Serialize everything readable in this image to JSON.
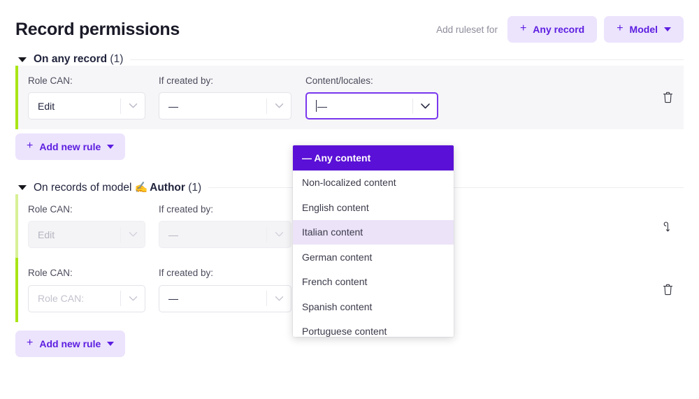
{
  "header": {
    "title": "Record permissions",
    "hint": "Add ruleset for",
    "any_record_button": "Any record",
    "model_button": "Model",
    "plus": "+"
  },
  "sections": [
    {
      "title_prefix": "On any record",
      "count": "(1)",
      "add_rule_label": "Add new rule",
      "rows": [
        {
          "shaded": true,
          "disabled": false,
          "action_icon": "trash-icon",
          "fields": [
            {
              "label": "Role CAN:",
              "value": "Edit",
              "placeholder": "",
              "state": "normal"
            },
            {
              "label": "If created by:",
              "value": "—",
              "placeholder": "",
              "state": "normal"
            },
            {
              "label": "Content/locales:",
              "value": "—",
              "placeholder": "",
              "state": "focused"
            }
          ]
        }
      ]
    },
    {
      "title_prefix": "On records of model",
      "model_emoji": "✍️",
      "model_name": "Author",
      "count": "(1)",
      "add_rule_label": "Add new rule",
      "rows": [
        {
          "shaded": false,
          "disabled": true,
          "action_icon": "restore-icon",
          "fields": [
            {
              "label": "Role CAN:",
              "value": "Edit",
              "placeholder": "",
              "state": "disabled"
            },
            {
              "label": "If created by:",
              "value": "—",
              "placeholder": "",
              "state": "disabled"
            }
          ]
        },
        {
          "shaded": false,
          "disabled": false,
          "action_icon": "trash-icon",
          "fields": [
            {
              "label": "Role CAN:",
              "value": "",
              "placeholder": "Role CAN:",
              "state": "placeholder"
            },
            {
              "label": "If created by:",
              "value": "—",
              "placeholder": "",
              "state": "normal"
            }
          ]
        }
      ]
    }
  ],
  "dropdown": {
    "open": true,
    "items": [
      {
        "label": "— Any content",
        "state": "selected"
      },
      {
        "label": "Non-localized content",
        "state": "normal"
      },
      {
        "label": "English content",
        "state": "normal"
      },
      {
        "label": "Italian content",
        "state": "hovered"
      },
      {
        "label": "German content",
        "state": "normal"
      },
      {
        "label": "French content",
        "state": "normal"
      },
      {
        "label": "Spanish content",
        "state": "normal"
      },
      {
        "label": "Portuguese content",
        "state": "normal"
      }
    ]
  },
  "colors": {
    "accent_purple": "#5c1ee0",
    "accent_purple_deep": "#5a10d6",
    "pill_bg": "#ece3fd",
    "rule_accent_green": "#a8e515",
    "rule_accent_green_faded": "#d8f096",
    "row_shade": "#f6f6f8"
  }
}
